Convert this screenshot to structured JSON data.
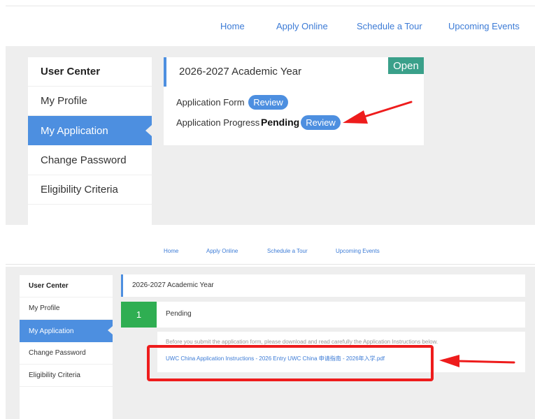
{
  "nav": {
    "home": "Home",
    "apply_online": "Apply Online",
    "schedule_tour": "Schedule a Tour",
    "upcoming_events": "Upcoming Events"
  },
  "sidebar": {
    "header": "User Center",
    "items": [
      {
        "label": "My Profile",
        "active": false
      },
      {
        "label": "My Application",
        "active": true
      },
      {
        "label": "Change Password",
        "active": false
      },
      {
        "label": "Eligibility Criteria",
        "active": false
      }
    ]
  },
  "application": {
    "academic_year": "2026-2027 Academic Year",
    "status_badge": "Open",
    "form_label": "Application Form",
    "form_button": "Review",
    "progress_label": "Application Progress",
    "progress_status": "Pending",
    "progress_button": "Review"
  },
  "detail": {
    "step_number": "1",
    "step_status": "Pending",
    "instructions_text": "Before you submit the application form, please download and read carefully the Application Instructions below.",
    "instructions_link": "UWC China Application Instructions - 2026 Entry UWC China 申请指南 - 2026年入学.pdf"
  },
  "colors": {
    "accent_blue": "#4d8fe0",
    "link_blue": "#3c7bd6",
    "open_green": "#3aa08a",
    "step_green": "#2fae52",
    "annotation_red": "#ee1c1c",
    "background_grey": "#eeeeee"
  }
}
